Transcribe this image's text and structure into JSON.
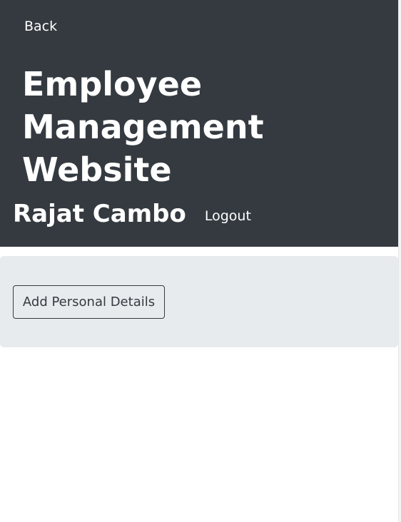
{
  "header": {
    "back_label": "Back",
    "title": "Employee Management Website",
    "user_name": "Rajat Cambo",
    "logout_label": "Logout"
  },
  "main": {
    "add_details_label": "Add Personal Details"
  },
  "colors": {
    "navbar_background": "#343a40",
    "panel_background": "#e7ebee",
    "text_light": "#ffffff",
    "button_border": "#343a40"
  }
}
